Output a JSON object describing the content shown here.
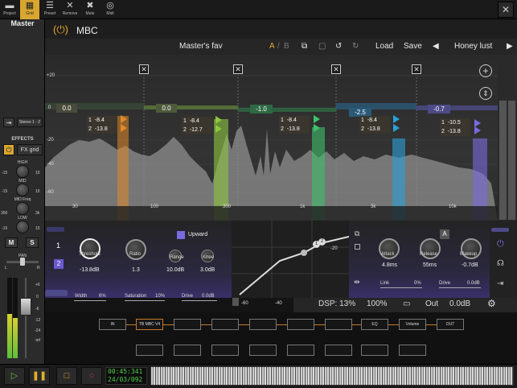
{
  "toolbar": {
    "items": [
      {
        "label": "Project",
        "icon": "folder-icon"
      },
      {
        "label": "Grid",
        "icon": "grid-icon"
      },
      {
        "label": "Preset",
        "icon": "list-icon"
      },
      {
        "label": "Remove",
        "icon": "close-icon"
      },
      {
        "label": "Mute",
        "icon": "mute-icon"
      },
      {
        "label": "Midi",
        "icon": "midi-icon"
      }
    ],
    "active_index": 1
  },
  "mixer": {
    "title": "Master",
    "input": "Stereo 1 - 2",
    "effects_label": "EFFECTS",
    "fx_grid": "FX grid",
    "eq": [
      {
        "label": "HIGH",
        "min": "-15",
        "max": "15"
      },
      {
        "label": "MID",
        "min": "-15",
        "max": "15"
      },
      {
        "label": "MID Freq",
        "min": "300",
        "max": "3k"
      },
      {
        "label": "LOW",
        "min": "-15",
        "max": "15"
      }
    ],
    "mute": "M",
    "solo": "S",
    "pan_label": "PAN",
    "pan_l": "L",
    "pan_r": "R",
    "fader_scale": [
      "+6",
      "0",
      "-6",
      "-12",
      "-24",
      "-inf"
    ]
  },
  "plugin": {
    "title": "MBC",
    "preset_name": "Master's fav",
    "ab": {
      "a": "A",
      "sep": "/",
      "b": "B"
    },
    "load": "Load",
    "save": "Save",
    "preset_nav": "Honey lust",
    "db_scale": [
      "+20",
      "0",
      "-20",
      "-40",
      "-60"
    ],
    "freq_scale": [
      "30",
      "100",
      "300",
      "1k",
      "3k",
      "10k"
    ],
    "bands": [
      {
        "gain": "0.0",
        "t1": "-8.4",
        "t2": "-13.8",
        "color": "#e08a2a"
      },
      {
        "gain": "0.0",
        "t1": "-8.4",
        "t2": "-12.7",
        "color": "#8dc63f"
      },
      {
        "gain": "-1.0",
        "t1": "-8.4",
        "t2": "-13.8",
        "color": "#3fc06a"
      },
      {
        "gain": "-2.5",
        "t1": "-8.4",
        "t2": "-13.8",
        "color": "#2aa0d8"
      },
      {
        "gain": "-0.7",
        "t1": "-10.5",
        "t2": "-13.8",
        "color": "#7a6ae0"
      }
    ],
    "band_index": "1",
    "band_index2": "2",
    "upward": "Upward",
    "threshold": {
      "label": "Threshold",
      "value": "-13.8dB"
    },
    "ratio": {
      "label": "Ratio",
      "value": "1.3"
    },
    "range": {
      "label": "Range",
      "value": "10.0dB"
    },
    "knee": {
      "label": "Knee",
      "value": "3.0dB"
    },
    "width": {
      "label": "Width",
      "value": "6%"
    },
    "saturation": {
      "label": "Saturation",
      "value": "10%"
    },
    "drive": {
      "label": "Drive",
      "value": "0.0dB"
    },
    "attack": {
      "label": "Attack",
      "value": "4.8ms"
    },
    "release": {
      "label": "Release",
      "value": "55ms"
    },
    "makeup": {
      "label": "Makeup",
      "value": "-0.7dB"
    },
    "link": {
      "label": "Link",
      "value": "0%"
    },
    "drive2": {
      "label": "Drive",
      "value": "0.0dB"
    },
    "a_badge": "A",
    "curve_axis": [
      "-60",
      "-40",
      "-20"
    ],
    "curve_nodes": [
      "1",
      "2"
    ],
    "dsp": "DSP: 13%",
    "zoom": "100%",
    "out_label": "Out",
    "out_value": "0.0dB"
  },
  "routing": {
    "slots": [
      "IN",
      "TB MBC V4",
      "",
      "",
      "",
      "",
      "EQ",
      "Volume",
      "OUT"
    ]
  },
  "transport": {
    "time": "00:45:341",
    "date": "24/03/092"
  }
}
